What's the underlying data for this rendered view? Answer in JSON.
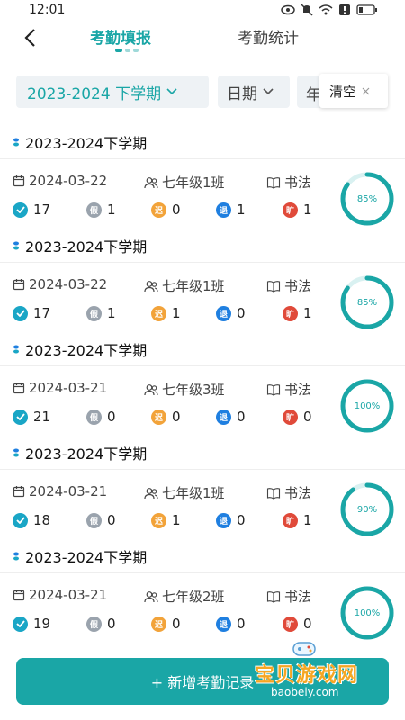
{
  "status_bar": {
    "time": "12:01"
  },
  "nav": {
    "tabs": [
      {
        "label": "考勤填报",
        "active": true
      },
      {
        "label": "考勤统计",
        "active": false
      }
    ]
  },
  "filters": {
    "term_label": "2023-2024 下学期",
    "date_label": "日期",
    "extra_label": "年",
    "clear_label": "清空"
  },
  "colors": {
    "accent": "#1aa6a6",
    "present": "#1aa6c6",
    "leave": "#9aa3ad",
    "late": "#f2a33a",
    "early": "#1f7fe0",
    "absent": "#e04a3a"
  },
  "stat_labels": {
    "present": "✓",
    "leave": "假",
    "late": "迟",
    "early": "退",
    "absent": "旷"
  },
  "records": [
    {
      "term": "2023-2024下学期",
      "date": "2024-03-22",
      "class": "七年级1班",
      "subject": "书法",
      "present": "17",
      "leave": "1",
      "late": "0",
      "early": "1",
      "absent": "1",
      "rate": "85%",
      "rate_value": 85
    },
    {
      "term": "2023-2024下学期",
      "date": "2024-03-22",
      "class": "七年级1班",
      "subject": "书法",
      "present": "17",
      "leave": "1",
      "late": "1",
      "early": "0",
      "absent": "1",
      "rate": "85%",
      "rate_value": 85
    },
    {
      "term": "2023-2024下学期",
      "date": "2024-03-21",
      "class": "七年级3班",
      "subject": "书法",
      "present": "21",
      "leave": "0",
      "late": "0",
      "early": "0",
      "absent": "0",
      "rate": "100%",
      "rate_value": 100
    },
    {
      "term": "2023-2024下学期",
      "date": "2024-03-21",
      "class": "七年级1班",
      "subject": "书法",
      "present": "18",
      "leave": "0",
      "late": "1",
      "early": "0",
      "absent": "1",
      "rate": "90%",
      "rate_value": 90
    },
    {
      "term": "2023-2024下学期",
      "date": "2024-03-21",
      "class": "七年级2班",
      "subject": "书法",
      "present": "19",
      "leave": "0",
      "late": "0",
      "early": "0",
      "absent": "0",
      "rate": "100%",
      "rate_value": 100
    }
  ],
  "add_button": {
    "label": "+ 新增考勤记录"
  },
  "watermark": {
    "text": "宝贝游戏网",
    "url": "baobeiy.com"
  }
}
